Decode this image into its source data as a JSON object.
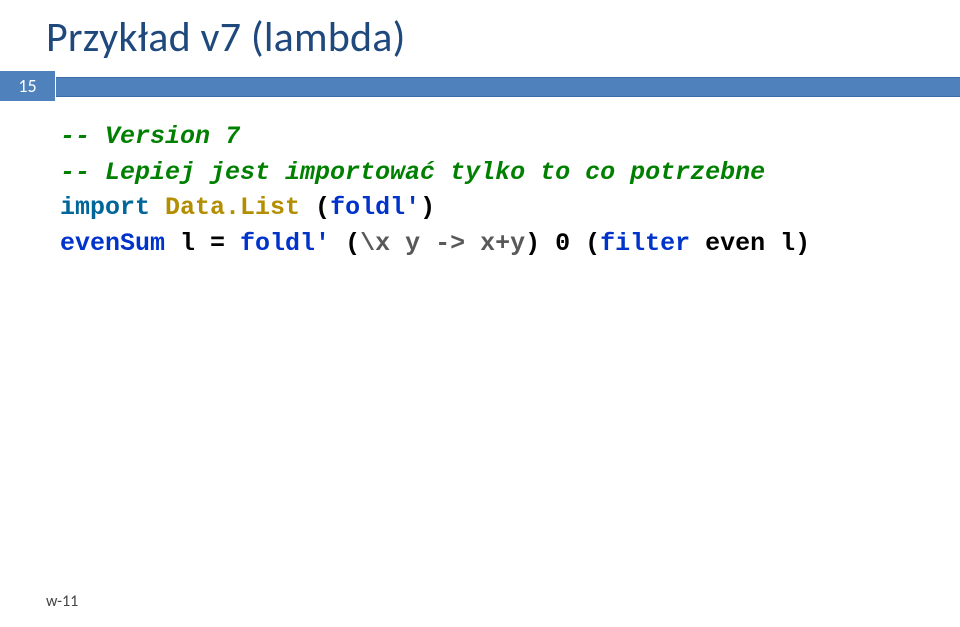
{
  "title": "Przykład v7 (lambda)",
  "page_number": "15",
  "code": {
    "c1": "-- Version 7",
    "c2": "-- Lepiej jest importować tylko to co potrzebne",
    "kw_import1": "import",
    "mod": " Data.List",
    "paren_o1": " (",
    "fn_foldl": "foldl'",
    "paren_c1": ")",
    "fn_evenSum": "evenSum",
    "eq_part": " l = ",
    "fn_foldl2": "foldl'",
    "paren_o2": " (",
    "lambda_body": "\\x y -> x+y",
    "after_lambda": ") 0 (",
    "kw_filter": "filter",
    "tail": " even l)"
  },
  "footer": "w-11"
}
